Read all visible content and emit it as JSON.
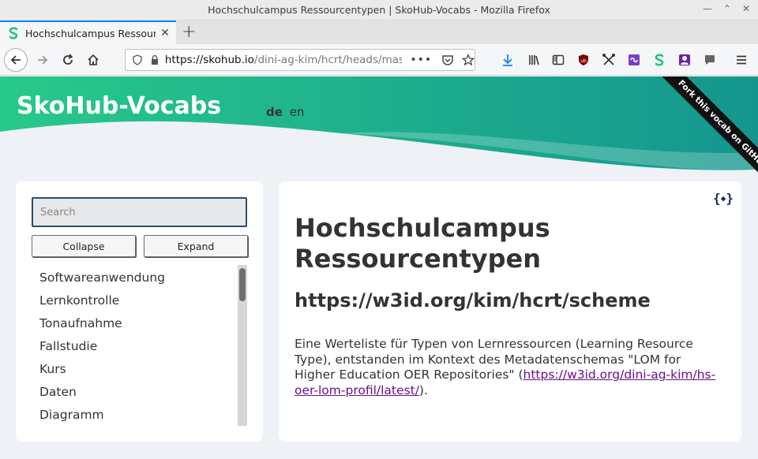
{
  "window": {
    "title": "Hochschulcampus Ressourcentypen | SkoHub-Vocabs - Mozilla Firefox"
  },
  "tab": {
    "label": "Hochschulcampus Ressourcentypen | SkoHub-Vocabs",
    "favicon": "skohub-icon"
  },
  "urlbar": {
    "host": "https://skohub.io",
    "path": "/dini-ag-kim/hcrt/heads/master/"
  },
  "page": {
    "brand": "SkoHub-Vocabs",
    "languages": [
      "de",
      "en"
    ],
    "current_language": "de",
    "ribbon": "Fork this vocab on GitHub",
    "search_placeholder": "Search",
    "collapse_label": "Collapse",
    "expand_label": "Expand",
    "concepts": [
      "Softwareanwendung",
      "Lernkontrolle",
      "Tonaufnahme",
      "Fallstudie",
      "Kurs",
      "Daten",
      "Diagramm"
    ],
    "title": "Hochschulcampus Ressourcentypen",
    "uri": "https://w3id.org/kim/hcrt/scheme",
    "description_prefix": "Eine Werteliste für Typen von Lernressourcen (Learning Resource Type), entstanden im Kontext des Metadatenschemas \"LOM for Higher Education OER Repositories\" (",
    "description_link": "https://w3id.org/dini-ag-kim/hs-oer-lom-profil/latest/",
    "description_suffix": ")."
  },
  "colors": {
    "header_gradient_start": "#28c98a",
    "header_gradient_end": "#14968f",
    "link": "#6a0f8e",
    "tab_accent": "#0a84ff"
  }
}
